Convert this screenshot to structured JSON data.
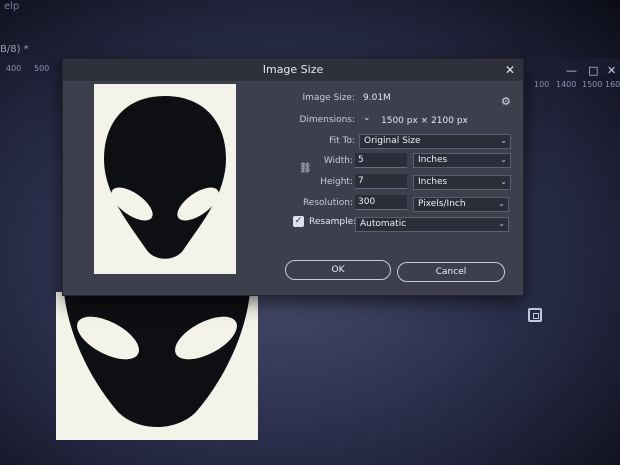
{
  "app": {
    "menu_help": "elp",
    "doc_tab": "B/8) *",
    "ruler": [
      "400",
      "500",
      "100",
      "1400",
      "1500",
      "1600"
    ],
    "window_buttons": {
      "minimize": "—",
      "maximize": "□",
      "close": "✕"
    }
  },
  "dialog": {
    "title": "Image Size",
    "close": "✕",
    "image_size_label": "Image Size:",
    "image_size_value": "9.01M",
    "settings_icon": "gear-icon",
    "settings_glyph": "⚙",
    "dimensions_label": "Dimensions:",
    "dimensions_toggle": "⌄",
    "dimensions_value": "1500 px  ×  2100 px",
    "fit_to_label": "Fit To:",
    "fit_to_value": "Original Size",
    "width_label": "Width:",
    "width_value": "5",
    "width_unit": "Inches",
    "height_label": "Height:",
    "height_value": "7",
    "height_unit": "Inches",
    "resolution_label": "Resolution:",
    "resolution_value": "300",
    "resolution_unit": "Pixels/Inch",
    "link_icon": "link-icon",
    "link_glyph": "⛓",
    "resample_label": "Resample:",
    "resample_checked": true,
    "resample_value": "Automatic",
    "ok_label": "OK",
    "cancel_label": "Cancel",
    "chevron": "⌄",
    "check_glyph": "✓"
  },
  "colors": {
    "dialog_bg": "#3d3f4c",
    "title_bg": "#2e303b",
    "field_bg": "#2b2d38",
    "alien": "#0e0f12",
    "eyes": "#f4f3ea"
  }
}
